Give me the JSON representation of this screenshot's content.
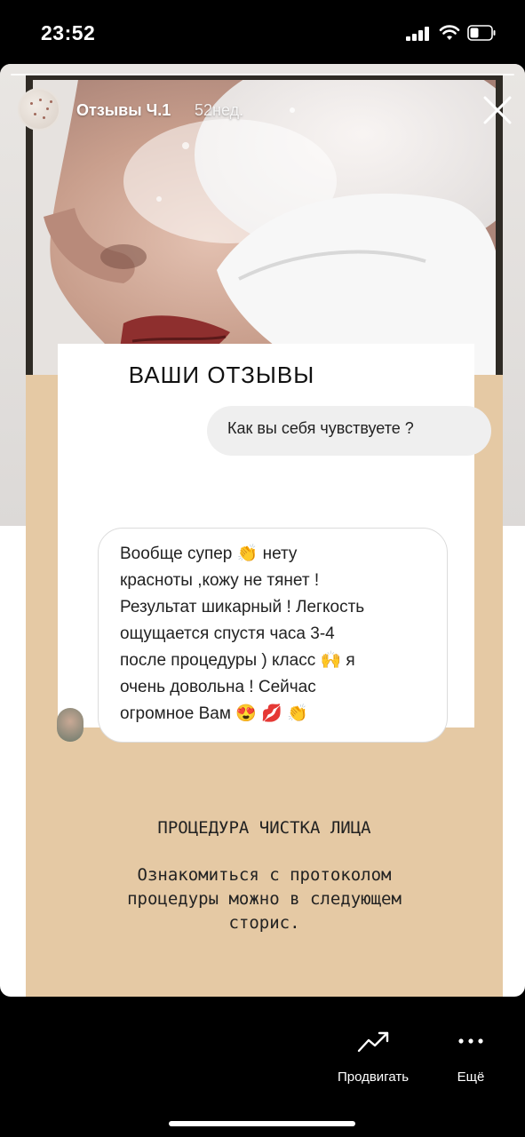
{
  "status_bar": {
    "time": "23:52"
  },
  "story": {
    "title": "Отзывы Ч.1",
    "age": "52нед."
  },
  "panel": {
    "heading": "ВАШИ  ОТЗЫВЫ",
    "question": "Как вы себя чувствуете ?",
    "answer_lines": [
      "Вообще супер 👏 нету",
      "красноты ,кожу не тянет !",
      "Результат шикарный ! Легкость",
      "ощущается спустя часа 3-4",
      "после процедуры ) класс 🙌 я",
      "очень довольна ! Сейчас",
      "огромное Вам 😍 💋 👏"
    ]
  },
  "procedure": {
    "title": "ПРОЦЕДУРА ЧИСТКА ЛИЦА",
    "lines": [
      "Ознакомиться с протоколом",
      "процедуры можно в следующем",
      "сторис."
    ]
  },
  "toolbar": {
    "promote_label": "Продвигать",
    "more_label": "Ещё"
  },
  "colors": {
    "beige": "#e5c9a4",
    "frame": "#2f2b25"
  },
  "icons": [
    "signal-icon",
    "wifi-icon",
    "battery-icon",
    "close-icon",
    "trend-up-icon",
    "more-icon"
  ]
}
